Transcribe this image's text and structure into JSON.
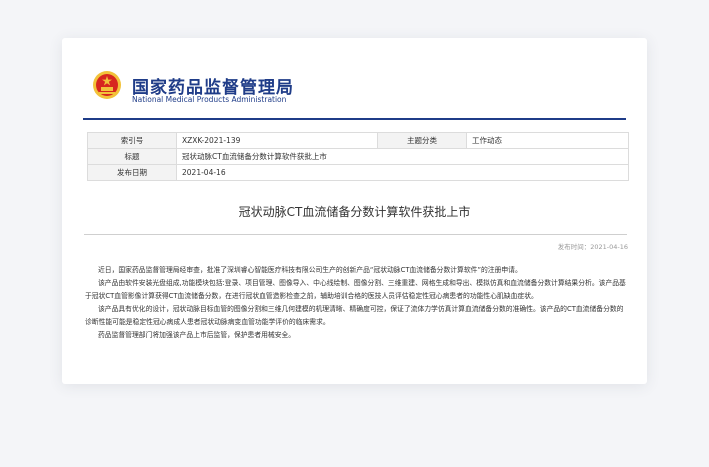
{
  "header": {
    "org_cn": "国家药品监督管理局",
    "org_en": "National Medical Products Administration"
  },
  "meta": {
    "index_label": "索引号",
    "index_value": "XZXK-2021-139",
    "category_label": "主题分类",
    "category_value": "工作动态",
    "title_label": "标题",
    "title_value": "冠状动脉CT血流储备分数计算软件获批上市",
    "date_label": "发布日期",
    "date_value": "2021-04-16"
  },
  "article": {
    "title": "冠状动脉CT血流储备分数计算软件获批上市",
    "publish_line": "发布时间：2021-04-16",
    "paragraphs": [
      "近日，国家药品监督管理局经审查，批准了深圳睿心智能医疗科技有限公司生产的创新产品“冠状动脉CT血流储备分数计算软件”的注册申请。",
      "该产品由软件安装光盘组成,功能模块包括:登录、项目管理、图像导入、中心线绘制、图像分割、三维重建、网格生成和导出、模拟仿真和血流储备分数计算结果分析。该产品基于冠状CT血管影像计算获得CT血流储备分数，在进行冠状血管造影检查之前，辅助培训合格的医技人员评估稳定性冠心病患者的功能性心肌缺血症状。",
      "该产品具有优化的设计，冠状动脉目标血管的图像分割和三维几何建模的机理清晰、精确度可控，保证了流体力学仿真计算血流储备分数的准确性。该产品的CT血流储备分数的诊断性能可能是稳定性冠心病成人患者冠状动脉病变血管功能学评价的临床需求。",
      "药品监督管理部门将加强该产品上市后监管，保护患者用械安全。"
    ]
  },
  "colors": {
    "brand_blue": "#1f3c88",
    "emblem_red": "#d7261f",
    "emblem_gold": "#f2c23a"
  }
}
